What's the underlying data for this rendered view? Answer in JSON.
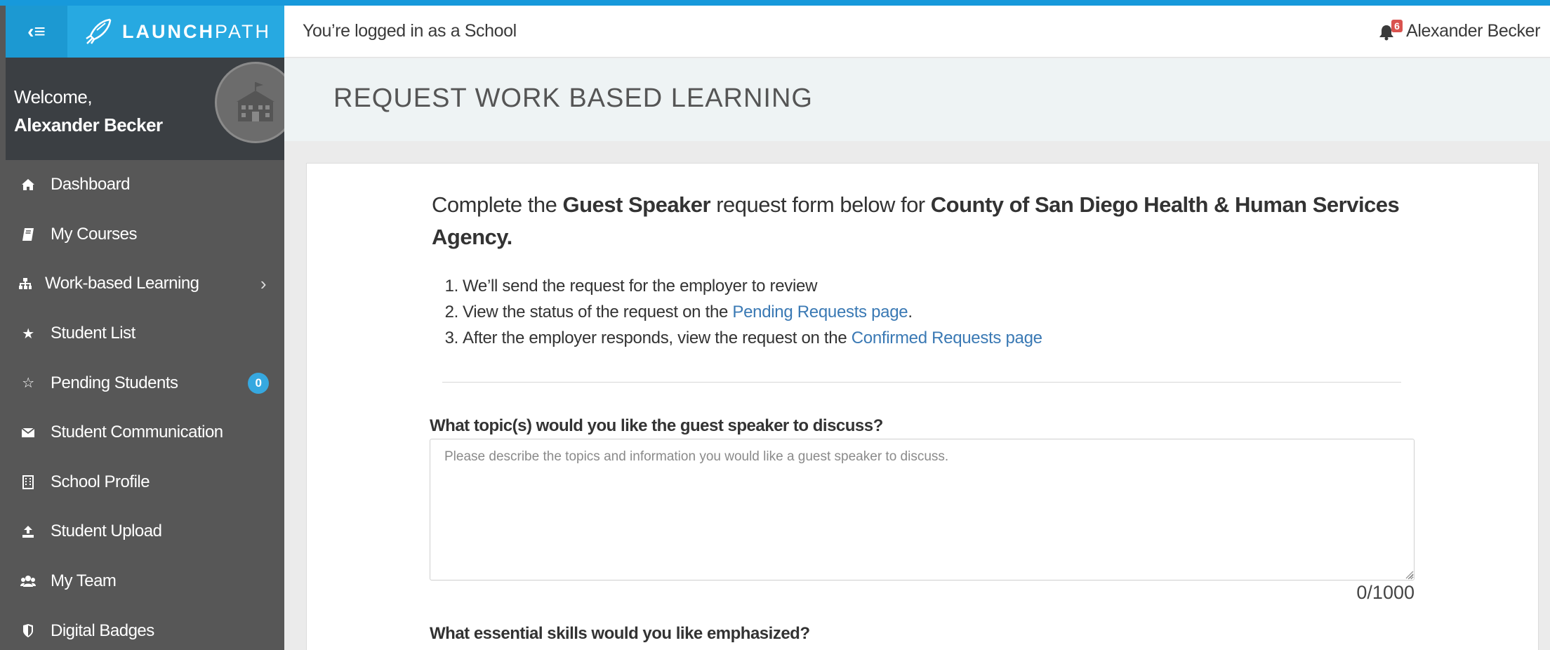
{
  "app": {
    "brand_bold": "LAUNCH",
    "brand_light": "PATH",
    "menu_toggle_icon": "menu-collapse-icon",
    "accent": "#27a9e1",
    "sidebar_bg": "#575757"
  },
  "header": {
    "login_status": "You’re logged in as a School",
    "notification_count": "6",
    "user_name": "Alexander Becker"
  },
  "sidebar": {
    "welcome": "Welcome,",
    "user_name": "Alexander Becker",
    "items": [
      {
        "label": "Dashboard",
        "icon": "home-icon"
      },
      {
        "label": "My Courses",
        "icon": "book-icon"
      },
      {
        "label": "Work-based Learning",
        "icon": "sitemap-icon",
        "chevron": "›"
      },
      {
        "label": "Student List",
        "icon": "star-icon"
      },
      {
        "label": "Pending Students",
        "icon": "star-outline-icon",
        "badge": "0"
      },
      {
        "label": "Student Communication",
        "icon": "envelope-icon"
      },
      {
        "label": "School Profile",
        "icon": "building-icon"
      },
      {
        "label": "Student Upload",
        "icon": "upload-icon"
      },
      {
        "label": "My Team",
        "icon": "users-icon"
      },
      {
        "label": "Digital Badges",
        "icon": "shield-icon"
      }
    ]
  },
  "page": {
    "title": "REQUEST WORK BASED LEARNING"
  },
  "form": {
    "intro_prefix": "Complete the ",
    "request_type": "Guest Speaker",
    "intro_middle": " request form below for ",
    "employer": "County of San Diego Health & Human Services Agency.",
    "steps": [
      {
        "num": "1.",
        "text": "We’ll send the request for the employer to review",
        "link": "",
        "suffix": ""
      },
      {
        "num": "2.",
        "text": "View the status of the request on the ",
        "link": "Pending Requests page",
        "suffix": "."
      },
      {
        "num": "3.",
        "text": "After the employer responds, view the request on the ",
        "link": "Confirmed Requests page",
        "suffix": ""
      }
    ],
    "q1_label": "What topic(s) would you like the guest speaker to discuss?",
    "q1_value": "",
    "q1_placeholder": "Please describe the topics and information you would like a guest speaker to discuss.",
    "q1_counter": "0/1000",
    "q2_label": "What essential skills would you like emphasized?"
  }
}
